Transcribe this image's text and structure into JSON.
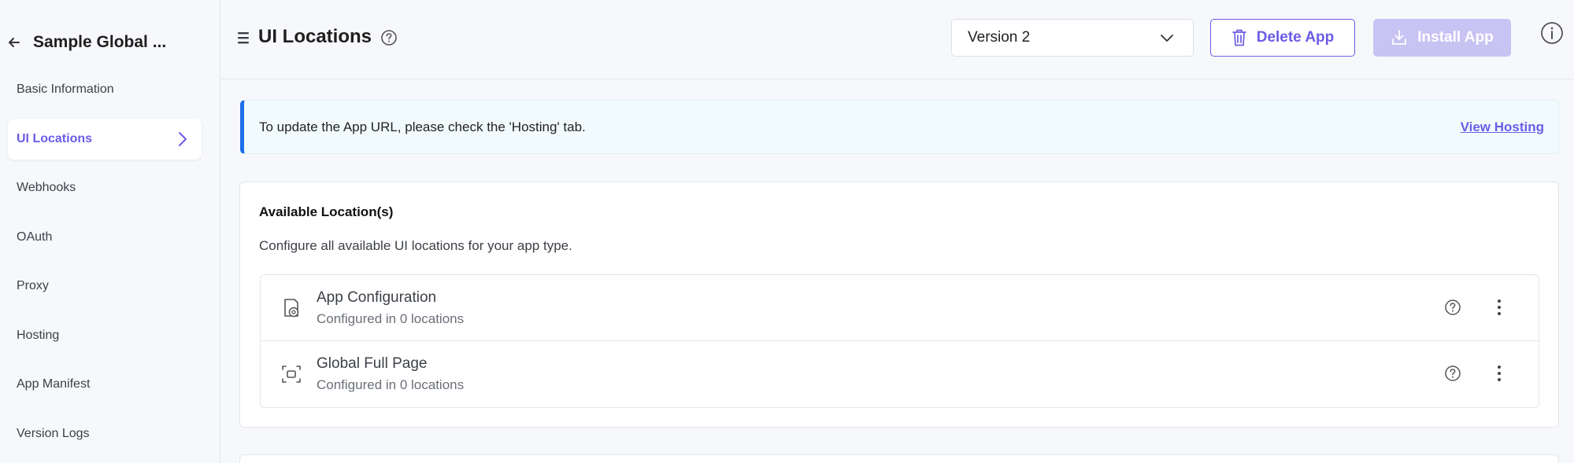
{
  "sidebar": {
    "app_name": "Sample Global ...",
    "items": [
      {
        "label": "Basic Information",
        "active": false
      },
      {
        "label": "UI Locations",
        "active": true
      },
      {
        "label": "Webhooks",
        "active": false
      },
      {
        "label": "OAuth",
        "active": false
      },
      {
        "label": "Proxy",
        "active": false
      },
      {
        "label": "Hosting",
        "active": false
      },
      {
        "label": "App Manifest",
        "active": false
      },
      {
        "label": "Version Logs",
        "active": false
      }
    ]
  },
  "header": {
    "title": "UI Locations",
    "version": "Version 2",
    "delete_label": "Delete App",
    "install_label": "Install App"
  },
  "banner": {
    "text": "To update the App URL, please check the 'Hosting' tab.",
    "link": "View Hosting"
  },
  "locations": {
    "title": "Available Location(s)",
    "description": "Configure all available UI locations for your app type.",
    "items": [
      {
        "name": "App Configuration",
        "status": "Configured in 0 locations",
        "icon": "app-config-icon"
      },
      {
        "name": "Global Full Page",
        "status": "Configured in 0 locations",
        "icon": "full-page-icon"
      }
    ]
  },
  "colors": {
    "accent": "#6c5ce7",
    "banner_border": "#1d6fe8",
    "install_disabled": "#c8c3f3"
  }
}
